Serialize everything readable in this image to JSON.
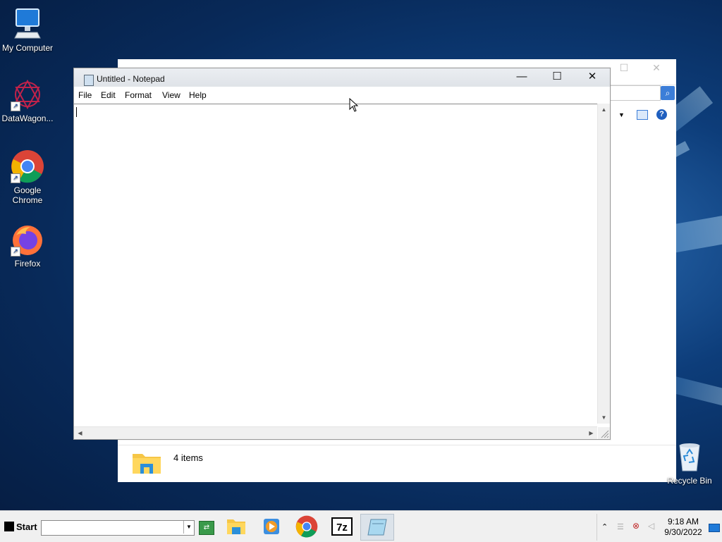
{
  "desktop": {
    "icons": [
      {
        "label": "My Computer"
      },
      {
        "label": "DataWagon..."
      },
      {
        "label": "Google Chrome"
      },
      {
        "label": "Firefox"
      }
    ],
    "recycle_bin_label": "Recycle Bin"
  },
  "explorer": {
    "status": "4 items"
  },
  "notepad": {
    "title": "Untitled - Notepad",
    "menu": [
      "File",
      "Edit",
      "Format",
      "View",
      "Help"
    ],
    "content": ""
  },
  "taskbar": {
    "start_label": "Start",
    "address_value": "",
    "clock_time": "9:18 AM",
    "clock_date": "9/30/2022"
  },
  "colors": {
    "accent": "#3c7ed8",
    "taskbar_bg": "#f0f0f0"
  }
}
